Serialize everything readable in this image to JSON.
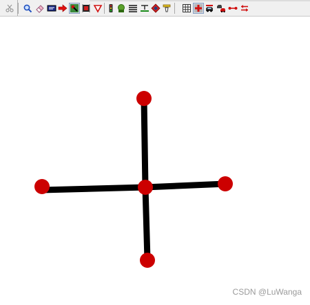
{
  "toolbar": {
    "icons": [
      "cut-icon",
      "search-icon",
      "eraser-icon",
      "display-icon",
      "arrow-right-icon",
      "select-tool-icon",
      "chip-icon",
      "triangle-down-icon",
      "traffic-light-icon",
      "home-icon",
      "lines-icon",
      "text-style-icon",
      "paint-icon",
      "measure-icon",
      "grid-icon",
      "crosshair-icon",
      "car-icon",
      "vehicle-pair-icon",
      "link-icon",
      "swap-icon"
    ],
    "pressed_icon": "select-tool-icon"
  },
  "graph": {
    "node_color": "#cc0000",
    "edge_color": "#000000",
    "nodes": [
      "center-node",
      "top-node",
      "left-node",
      "right-node",
      "bottom-node"
    ],
    "edges": [
      [
        "center-node",
        "top-node"
      ],
      [
        "center-node",
        "left-node"
      ],
      [
        "center-node",
        "right-node"
      ],
      [
        "center-node",
        "bottom-node"
      ]
    ]
  },
  "watermark": {
    "text": "CSDN @LuWanga"
  }
}
